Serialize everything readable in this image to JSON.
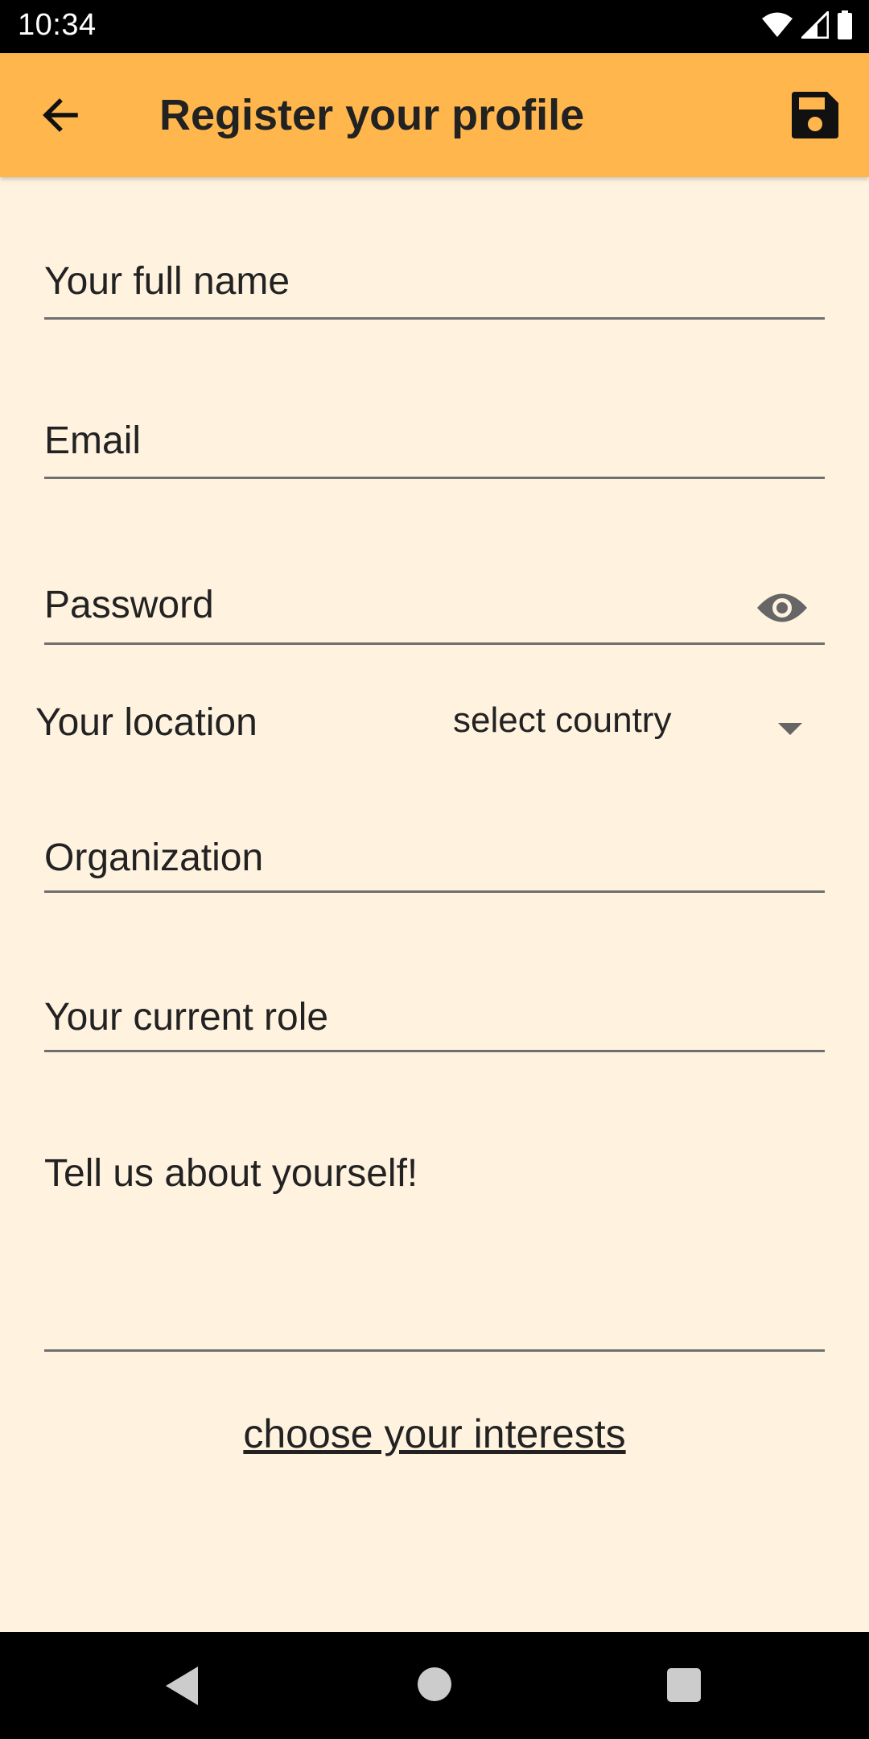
{
  "status_bar": {
    "time": "10:34",
    "icons": [
      "wifi-icon",
      "signal-icon",
      "battery-icon"
    ]
  },
  "app_bar": {
    "title": "Register your profile",
    "back_icon": "arrow-back-icon",
    "save_icon": "save-floppy-icon",
    "background_color": "#FFB74D"
  },
  "form": {
    "full_name_placeholder": "Your full name",
    "email_placeholder": "Email",
    "password_placeholder": "Password",
    "password_toggle_icon": "eye-icon",
    "location_label": "Your location",
    "country_select_value": "select country",
    "organization_placeholder": "Organization",
    "role_placeholder": "Your current role",
    "about_placeholder": "Tell us about yourself!",
    "interests_link": "choose your interests"
  },
  "nav_bar": {
    "icons": [
      "nav-back-icon",
      "nav-home-icon",
      "nav-recents-icon"
    ]
  },
  "colors": {
    "page_background": "#FFF3E0",
    "underline": "#6F6F6F"
  }
}
